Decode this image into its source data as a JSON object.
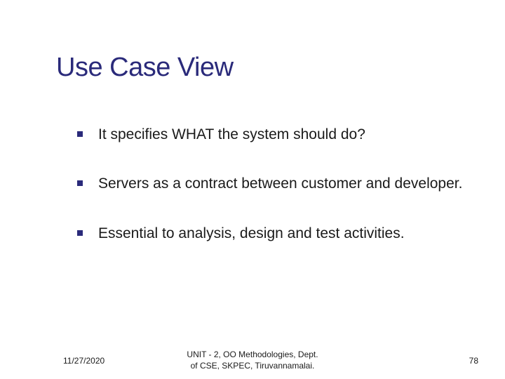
{
  "title": "Use Case View",
  "bullets": [
    "It specifies WHAT the system should do?",
    "Servers as a contract between customer and developer.",
    "Essential to analysis, design and test activities."
  ],
  "footer": {
    "date": "11/27/2020",
    "center": "UNIT - 2, OO Methodologies, Dept.\nof CSE, SKPEC, Tiruvannamalai.",
    "page": "78"
  }
}
